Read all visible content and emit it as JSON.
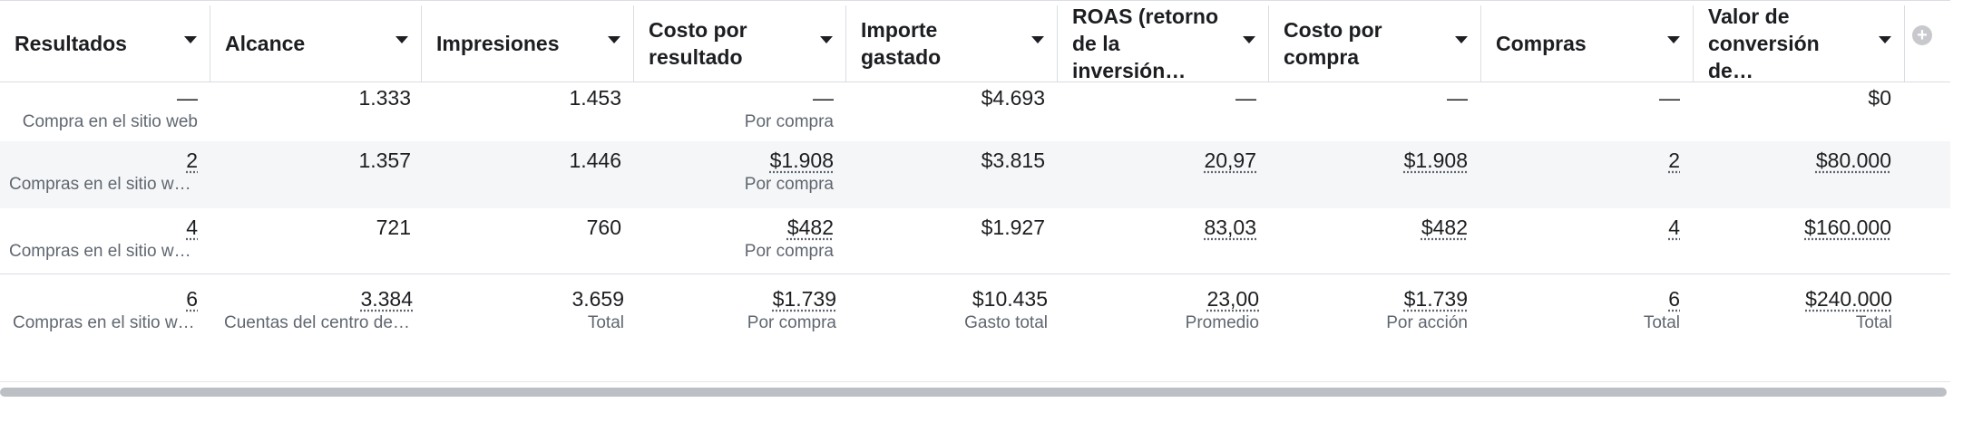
{
  "columns": [
    {
      "label": "Resultados"
    },
    {
      "label": "Alcance"
    },
    {
      "label": "Impresiones"
    },
    {
      "label": "Costo por resultado"
    },
    {
      "label": "Importe gastado"
    },
    {
      "label": "ROAS (retorno de la inversión…"
    },
    {
      "label": "Costo por compra"
    },
    {
      "label": "Compras"
    },
    {
      "label": "Valor de conversión de…"
    }
  ],
  "add_column_symbol": "+",
  "rows": [
    {
      "cells": [
        {
          "value": "—",
          "sub": "Compra en el sitio web"
        },
        {
          "value": "1.333",
          "sub": ""
        },
        {
          "value": "1.453",
          "sub": ""
        },
        {
          "value": "—",
          "sub": "Por compra"
        },
        {
          "value": "$4.693",
          "sub": ""
        },
        {
          "value": "—",
          "sub": ""
        },
        {
          "value": "—",
          "sub": ""
        },
        {
          "value": "—",
          "sub": ""
        },
        {
          "value": "$0",
          "sub": ""
        }
      ]
    },
    {
      "cells": [
        {
          "value": "2",
          "sub": "Compras en el sitio w…"
        },
        {
          "value": "1.357",
          "sub": ""
        },
        {
          "value": "1.446",
          "sub": ""
        },
        {
          "value": "$1.908",
          "sub": "Por compra"
        },
        {
          "value": "$3.815",
          "sub": ""
        },
        {
          "value": "20,97",
          "sub": ""
        },
        {
          "value": "$1.908",
          "sub": ""
        },
        {
          "value": "2",
          "sub": ""
        },
        {
          "value": "$80.000",
          "sub": ""
        }
      ]
    },
    {
      "cells": [
        {
          "value": "4",
          "sub": "Compras en el sitio w…"
        },
        {
          "value": "721",
          "sub": ""
        },
        {
          "value": "760",
          "sub": ""
        },
        {
          "value": "$482",
          "sub": "Por compra"
        },
        {
          "value": "$1.927",
          "sub": ""
        },
        {
          "value": "83,03",
          "sub": ""
        },
        {
          "value": "$482",
          "sub": ""
        },
        {
          "value": "4",
          "sub": ""
        },
        {
          "value": "$160.000",
          "sub": ""
        }
      ]
    }
  ],
  "totals": {
    "cells": [
      {
        "value": "6",
        "sub": "Compras en el sitio w…"
      },
      {
        "value": "3.384",
        "sub": "Cuentas del centro de…"
      },
      {
        "value": "3.659",
        "sub": "Total"
      },
      {
        "value": "$1.739",
        "sub": "Por compra"
      },
      {
        "value": "$10.435",
        "sub": "Gasto total"
      },
      {
        "value": "23,00",
        "sub": "Promedio"
      },
      {
        "value": "$1.739",
        "sub": "Por acción"
      },
      {
        "value": "6",
        "sub": "Total"
      },
      {
        "value": "$240.000",
        "sub": "Total"
      }
    ]
  }
}
